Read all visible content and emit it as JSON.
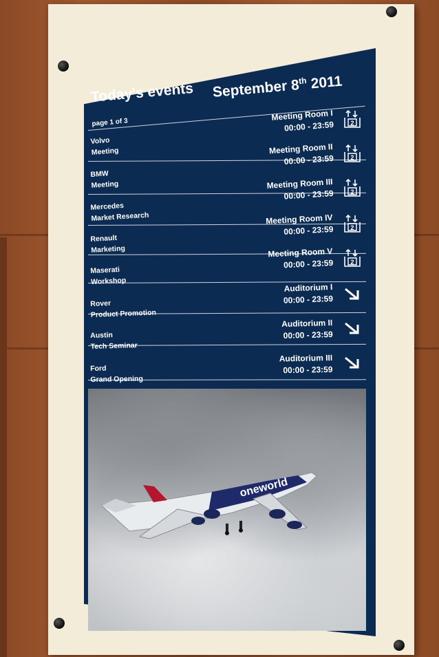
{
  "header": {
    "title": "Today's events",
    "page_indicator": "page 1 of 3",
    "date_month_day": "September 8",
    "date_suffix": "th",
    "date_year": "2011"
  },
  "events": [
    {
      "company": "Volvo",
      "type": "Meeting",
      "room": "Meeting Room I",
      "time": "00:00 - 23:59",
      "icon": "floor-2-up-down-icon",
      "floor": "2"
    },
    {
      "company": "BMW",
      "type": "Meeting",
      "room": "Meeting Room II",
      "time": "00:00 - 23:59",
      "icon": "floor-2-up-down-icon",
      "floor": "2"
    },
    {
      "company": "Mercedes",
      "type": "Market Research",
      "room": "Meeting Room III",
      "time": "00:00 - 23:59",
      "icon": "floor-2-up-down-icon",
      "floor": "2"
    },
    {
      "company": "Renault",
      "type": "Marketing",
      "room": "Meeting Room IV",
      "time": "00:00 - 23:59",
      "icon": "floor-2-up-down-icon",
      "floor": "2"
    },
    {
      "company": "Maserati",
      "type": "Workshop",
      "room": "Meeting Room V",
      "time": "00:00 - 23:59",
      "icon": "floor-2-up-down-icon",
      "floor": "2"
    },
    {
      "company": "Rover",
      "type": "Product Promotion",
      "room": "Auditorium I",
      "time": "00:00 - 23:59",
      "icon": "arrow-down-right-icon"
    },
    {
      "company": "Austin",
      "type": "Tech Seminar",
      "room": "Auditorium II",
      "time": "00:00 - 23:59",
      "icon": "arrow-down-right-icon"
    },
    {
      "company": "Ford",
      "type": "Grand Opening",
      "room": "Auditorium III",
      "time": "00:00 - 23:59",
      "icon": "arrow-down-right-icon"
    }
  ],
  "photo": {
    "livery_text": "oneworld"
  },
  "colors": {
    "screen_bg": "#0c2b52",
    "frame": "#f3ecd9",
    "wall": "#9a5430"
  }
}
